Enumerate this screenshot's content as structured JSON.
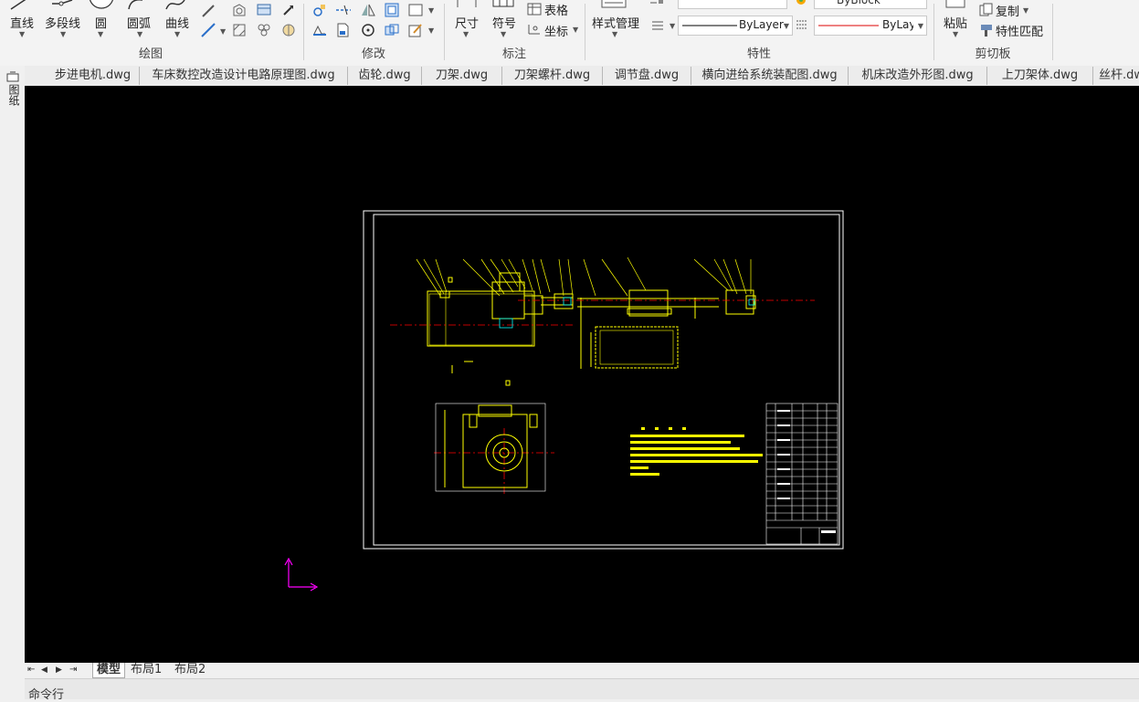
{
  "ribbon": {
    "draw": {
      "label": "绘图",
      "line": "直线",
      "polyline": "多段线",
      "circle": "圆",
      "arc": "圆弧",
      "curve": "曲线"
    },
    "modify": {
      "label": "修改"
    },
    "annotate": {
      "label": "标注",
      "dimension": "尺寸",
      "symbol": "符号",
      "table": "表格",
      "coordinate": "坐标"
    },
    "properties": {
      "label": "特性",
      "style_manager": "样式管理",
      "linetype": "ByLayer",
      "lineweight": "ByLayer",
      "color": "ByBlock"
    },
    "clipboard": {
      "label": "剪切板",
      "paste": "粘贴",
      "copy": "复制",
      "match_prop": "特性匹配"
    }
  },
  "file_tabs": [
    "步进电机.dwg",
    "车床数控改造设计电路原理图.dwg",
    "齿轮.dwg",
    "刀架.dwg",
    "刀架螺杆.dwg",
    "调节盘.dwg",
    "横向进给系统装配图.dwg",
    "机床改造外形图.dwg",
    "上刀架体.dwg",
    "丝杆.dwg"
  ],
  "left_panel": {
    "label": "图纸"
  },
  "layout_tabs": [
    "模型",
    "布局1",
    "布局2"
  ],
  "command_line": {
    "label": "命令行"
  },
  "colors": {
    "drawing": "#ffff00",
    "center": "#ff0000",
    "cyan": "#00ffff",
    "ucs": "#ff00ff",
    "frame": "#ffffff"
  }
}
